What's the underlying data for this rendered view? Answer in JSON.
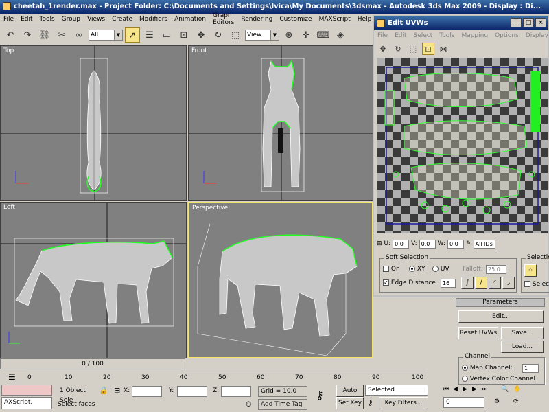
{
  "app": {
    "title": "cheetah_1render.max     - Project Folder: C:\\Documents and Settings\\lvica\\My Documents\\3dsmax    - Autodesk 3ds Max  2009        - Display : Di..."
  },
  "menu": [
    "File",
    "Edit",
    "Tools",
    "Group",
    "Views",
    "Create",
    "Modifiers",
    "Animation",
    "Graph Editors",
    "Rendering",
    "Customize",
    "MAXScript",
    "Help"
  ],
  "toolbar": {
    "selection_filter": "All",
    "ref_coord": "View"
  },
  "viewports": {
    "top": "Top",
    "front": "Front",
    "left": "Left",
    "perspective": "Perspective"
  },
  "uv_editor": {
    "title": "Edit UVWs",
    "menu": [
      "File",
      "Edit",
      "Select",
      "Tools",
      "Mapping",
      "Options",
      "Display"
    ],
    "window_buttons": [
      "_",
      "□",
      "×"
    ],
    "u_label": "U:",
    "u_value": "0.0",
    "v_label": "V:",
    "v_value": "0.0",
    "w_label": "W:",
    "w_value": "0.0",
    "ids_label": "All IDs",
    "soft_selection": {
      "title": "Soft Selection",
      "on_label": "On",
      "xy_label": "XY",
      "uv_label": "UV",
      "falloff_label": "Falloff:",
      "falloff_value": "25.0",
      "edge_distance_label": "Edge Distance",
      "edge_distance_value": "16"
    },
    "selection": {
      "title": "Selection",
      "select_label": "Selec"
    }
  },
  "command_panel": {
    "rollout": "Parameters",
    "edit_label": "Edit...",
    "reset_label": "Reset UVWs",
    "save_label": "Save...",
    "load_label": "Load...",
    "channel_title": "Channel",
    "map_channel_label": "Map Channel:",
    "map_channel_value": "1",
    "vertex_color_label": "Vertex Color Channel"
  },
  "timeline": {
    "slider": "0 / 100",
    "ticks": [
      "0",
      "10",
      "20",
      "30",
      "40",
      "50",
      "60",
      "70",
      "80",
      "90",
      "100"
    ]
  },
  "status": {
    "maxscript": "AXScript.",
    "selected": "1 Object Sele",
    "x_label": "X:",
    "y_label": "Y:",
    "z_label": "Z:",
    "grid": "Grid = 10.0",
    "auto_key": "Auto Key",
    "set_key": "Set Key",
    "key_mode": "Selected",
    "key_filters": "Key Filters...",
    "add_time_tag": "Add Time Tag",
    "prompt": "Select faces",
    "frame": "0"
  }
}
